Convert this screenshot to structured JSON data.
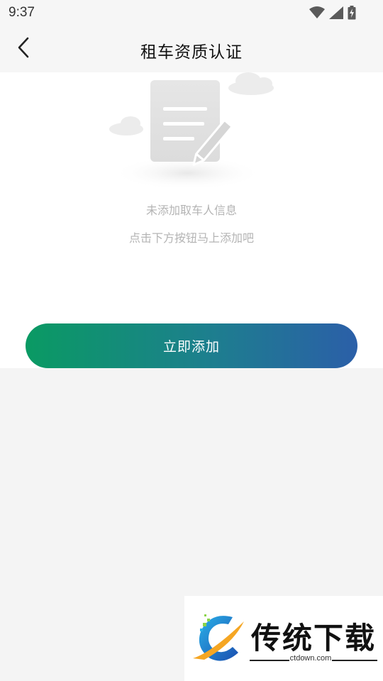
{
  "status_bar": {
    "time": "9:37",
    "icons": [
      "wifi-icon",
      "signal-icon",
      "battery-charging-icon"
    ]
  },
  "header": {
    "title": "租车资质认证",
    "back_icon": "chevron-left-icon"
  },
  "empty_state": {
    "illustration": "document-edit-icon",
    "line1": "未添加取车人信息",
    "line2": "点击下方按钮马上添加吧"
  },
  "actions": {
    "add_label": "立即添加"
  },
  "watermark": {
    "brand": "传统下载",
    "url": "ctdown.com"
  },
  "colors": {
    "button_gradient_start": "#0a9a63",
    "button_gradient_end": "#2b5fa8",
    "background": "#f4f4f4",
    "hint_text": "#b4b4b4"
  }
}
